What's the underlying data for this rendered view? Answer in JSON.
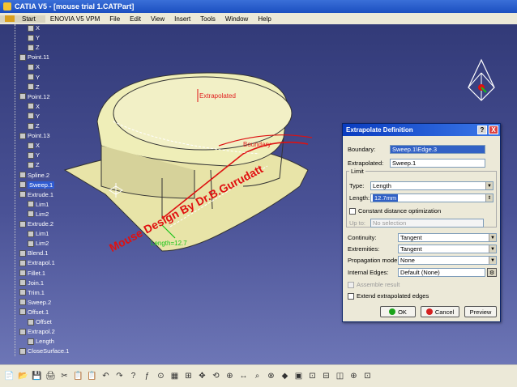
{
  "window": {
    "title": "CATIA V5 - [mouse trial 1.CATPart]"
  },
  "menu": {
    "items": [
      "Start",
      "ENOVIA V5 VPM",
      "File",
      "Edit",
      "View",
      "Insert",
      "Tools",
      "Window",
      "Help"
    ]
  },
  "tree": {
    "items": [
      {
        "label": "X",
        "depth": 3
      },
      {
        "label": "Y",
        "depth": 3
      },
      {
        "label": "Z",
        "depth": 3
      },
      {
        "label": "Point.11",
        "depth": 2
      },
      {
        "label": "X",
        "depth": 3
      },
      {
        "label": "Y",
        "depth": 3
      },
      {
        "label": "Z",
        "depth": 3
      },
      {
        "label": "Point.12",
        "depth": 2
      },
      {
        "label": "X",
        "depth": 3
      },
      {
        "label": "Y",
        "depth": 3
      },
      {
        "label": "Z",
        "depth": 3
      },
      {
        "label": "Point.13",
        "depth": 2
      },
      {
        "label": "X",
        "depth": 3
      },
      {
        "label": "Y",
        "depth": 3
      },
      {
        "label": "Z",
        "depth": 3
      },
      {
        "label": "Spline.2",
        "depth": 2
      },
      {
        "label": "Sweep.1",
        "depth": 2,
        "selected": true
      },
      {
        "label": "Extrude.1",
        "depth": 2
      },
      {
        "label": "Lim1",
        "depth": 3
      },
      {
        "label": "Lim2",
        "depth": 3
      },
      {
        "label": "Extrude.2",
        "depth": 2
      },
      {
        "label": "Lim1",
        "depth": 3
      },
      {
        "label": "Lim2",
        "depth": 3
      },
      {
        "label": "Blend.1",
        "depth": 2
      },
      {
        "label": "Extrapol.1",
        "depth": 2
      },
      {
        "label": "Fillet.1",
        "depth": 2
      },
      {
        "label": "Join.1",
        "depth": 2
      },
      {
        "label": "Trim.1",
        "depth": 2
      },
      {
        "label": "Sweep.2",
        "depth": 2
      },
      {
        "label": "Offset.1",
        "depth": 2
      },
      {
        "label": "Offset",
        "depth": 3
      },
      {
        "label": "Extrapol.2",
        "depth": 2
      },
      {
        "label": "Length",
        "depth": 3
      },
      {
        "label": "CloseSurface.1",
        "depth": 2
      }
    ]
  },
  "viewport": {
    "label_extrapolated": "Extrapolated",
    "label_boundary": "Boundary",
    "label_length": "Length=12.7",
    "watermark": "Mouse Design By Dr.B.Gurudatt"
  },
  "dialog": {
    "title": "Extrapolate Definition",
    "help": "?",
    "close": "X",
    "boundary_label": "Boundary:",
    "boundary_value": "Sweep.1\\Edge.3",
    "extrapolated_label": "Extrapolated:",
    "extrapolated_value": "Sweep.1",
    "limit_group": "Limit",
    "type_label": "Type:",
    "type_value": "Length",
    "length_label": "Length:",
    "length_value": "12.7mm",
    "constant_distance": "Constant distance optimization",
    "upto_label": "Up to:",
    "upto_value": "No selection",
    "continuity_label": "Continuity:",
    "continuity_value": "Tangent",
    "extremities_label": "Extremities:",
    "extremities_value": "Tangent",
    "propagation_label": "Propagation mode:",
    "propagation_value": "None",
    "internal_label": "Internal Edges:",
    "internal_value": "Default (None)",
    "assemble_result": "Assemble result",
    "extend_edges": "Extend extrapolated edges",
    "ok": "OK",
    "cancel": "Cancel",
    "preview": "Preview"
  },
  "colors": {
    "ok_dot": "#1aa31a",
    "cancel_dot": "#d42020",
    "highlight": "#3161c5"
  }
}
